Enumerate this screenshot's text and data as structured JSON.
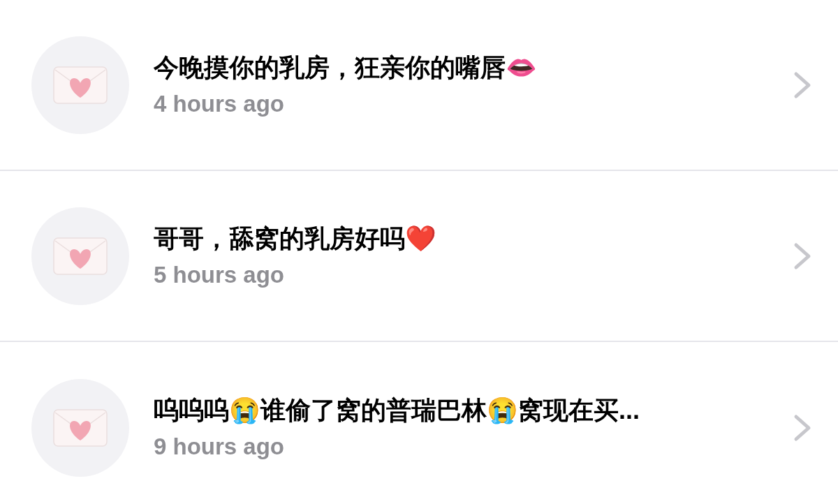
{
  "messages": [
    {
      "title": "今晚摸你的乳房，狂亲你的嘴唇👄",
      "time": "4 hours ago"
    },
    {
      "title": "哥哥，舔窝的乳房好吗❤️",
      "time": "5 hours ago"
    },
    {
      "title": "呜呜呜😭谁偷了窝的普瑞巴林😭窝现在买...",
      "time": "9 hours ago"
    }
  ]
}
